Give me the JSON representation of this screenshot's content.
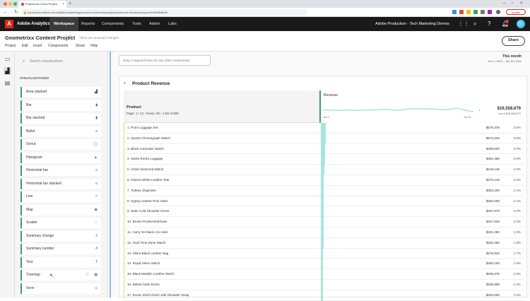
{
  "browser": {
    "tab_title": "Experience Cloud Project",
    "url": "experience.adobe.com/#/@techmarketingdemos/so:techma0/analytics/spa/index.html#/workspace/edit/5ffd8b9e",
    "update_label": "Update"
  },
  "topnav": {
    "brand": "Adobe Analytics",
    "items": [
      "Workspace",
      "Reports",
      "Components",
      "Tools",
      "Admin",
      "Labs"
    ],
    "org": "Adobe Production - Tech Marketing Demos",
    "notification_count": "1"
  },
  "project": {
    "title": "Geometrixx Content Project",
    "unsaved": "There are unsaved changes",
    "menu": [
      "Project",
      "Edit",
      "Insert",
      "Components",
      "Share",
      "Help"
    ],
    "share_label": "Share"
  },
  "panel": {
    "search_placeholder": "Search visualizations",
    "heading": "VISUALIZATIONS",
    "items": [
      {
        "label": "Area stacked",
        "icon": "area-stacked-icon",
        "glyph": "▟"
      },
      {
        "label": "Bar",
        "icon": "bar-icon",
        "glyph": "▮"
      },
      {
        "label": "Bar stacked",
        "icon": "bar-stacked-icon",
        "glyph": "▮"
      },
      {
        "label": "Bullet",
        "icon": "bullet-icon",
        "glyph": "≡"
      },
      {
        "label": "Donut",
        "icon": "donut-icon",
        "glyph": "◯"
      },
      {
        "label": "Histogram",
        "icon": "histogram-icon",
        "glyph": "▲"
      },
      {
        "label": "Horizontal bar",
        "icon": "horizontal-bar-icon",
        "glyph": "≡"
      },
      {
        "label": "Horizontal bar stacked",
        "icon": "horizontal-bar-stacked-icon",
        "glyph": "≡"
      },
      {
        "label": "Line",
        "icon": "line-icon",
        "glyph": "↗"
      },
      {
        "label": "Map",
        "icon": "map-icon",
        "glyph": "◉"
      },
      {
        "label": "Scatter",
        "icon": "scatter-icon",
        "glyph": "⁘"
      },
      {
        "label": "Summary change",
        "icon": "summary-change-icon",
        "glyph": "±"
      },
      {
        "label": "Summary number",
        "icon": "summary-number-icon",
        "glyph": "#"
      },
      {
        "label": "Text",
        "icon": "text-icon",
        "glyph": "T"
      },
      {
        "label": "Treemap",
        "icon": "treemap-icon",
        "glyph": "▦"
      },
      {
        "label": "Venn",
        "icon": "venn-icon",
        "glyph": "∞"
      }
    ]
  },
  "main": {
    "segment_placeholder": "Drop a segment here (or any other component)",
    "date_label": "This month",
    "date_range": "Jun 1, 2021 - Jun 30, 2021"
  },
  "table": {
    "title": "Product Revenue",
    "dimension": "Product",
    "page_info": "Page:  1  / 12  ›   Rows:  50  ›   1-50 of 596",
    "metric": "Revenue",
    "spark_start": "Jun 1",
    "spark_end": "Jun 30",
    "total": "$16,558,679",
    "total_sub": "out of $16,558,679",
    "rows": [
      {
        "label": "1. Purni Luggage Set",
        "value": "$579,375",
        "pct": "3.5%",
        "share": 0.035
      },
      {
        "label": "2. Quartz Chronograph Watch",
        "value": "$574,225",
        "pct": "3.5%",
        "share": 0.035
      },
      {
        "label": "3. Black Automatic Watch",
        "value": "$499,500",
        "pct": "3.0%",
        "share": 0.03
      },
      {
        "label": "4. Swiss Rocks Luggage",
        "value": "$481,380",
        "pct": "2.9%",
        "share": 0.029
      },
      {
        "label": "5. Urban Diamond Watch",
        "value": "$418,145",
        "pct": "2.5%",
        "share": 0.025
      },
      {
        "label": "6. Glazed White Leather Tote",
        "value": "$370,146",
        "pct": "2.2%",
        "share": 0.022
      },
      {
        "label": "7. Toiletry Organizer",
        "value": "$352,200",
        "pct": "2.1%",
        "share": 0.021
      },
      {
        "label": "8. Gypsy Leather Pink Hobo",
        "value": "$352,000",
        "pct": "2.1%",
        "share": 0.021
      },
      {
        "label": "9. Satin Cold Shoulder Dress",
        "value": "$337,870",
        "pct": "2.0%",
        "share": 0.02
      },
      {
        "label": "10. Brown Pocket Briefcase",
        "value": "$327,630",
        "pct": "2.0%",
        "share": 0.02
      },
      {
        "label": "11. Carry On black croc skin",
        "value": "$321,360",
        "pct": "1.9%",
        "share": 0.019
      },
      {
        "label": "12. Oval Time-Zone Watch",
        "value": "$293,250",
        "pct": "1.8%",
        "share": 0.018
      },
      {
        "label": "13. Albert Black Leather Bag",
        "value": "$275,940",
        "pct": "1.7%",
        "share": 0.017
      },
      {
        "label": "14. Royal Silver Watch",
        "value": "$260,190",
        "pct": "1.6%",
        "share": 0.016
      },
      {
        "label": "15. Black Metallic Leather Watch",
        "value": "$259,375",
        "pct": "1.6%",
        "share": 0.016
      },
      {
        "label": "16. Belted Satin Dress",
        "value": "$255,990",
        "pct": "1.5%",
        "share": 0.015
      },
      {
        "label": "17. Exotic Shell Clutch with Shoulder Strap",
        "value": "$253,000",
        "pct": "1.5%",
        "share": 0.015
      }
    ]
  },
  "colors": {
    "accent_green": "#3e9b73",
    "bar_teal": "#a9e5dd",
    "adobe_red": "#e1251b",
    "gutter_blue": "#8fb3df"
  }
}
